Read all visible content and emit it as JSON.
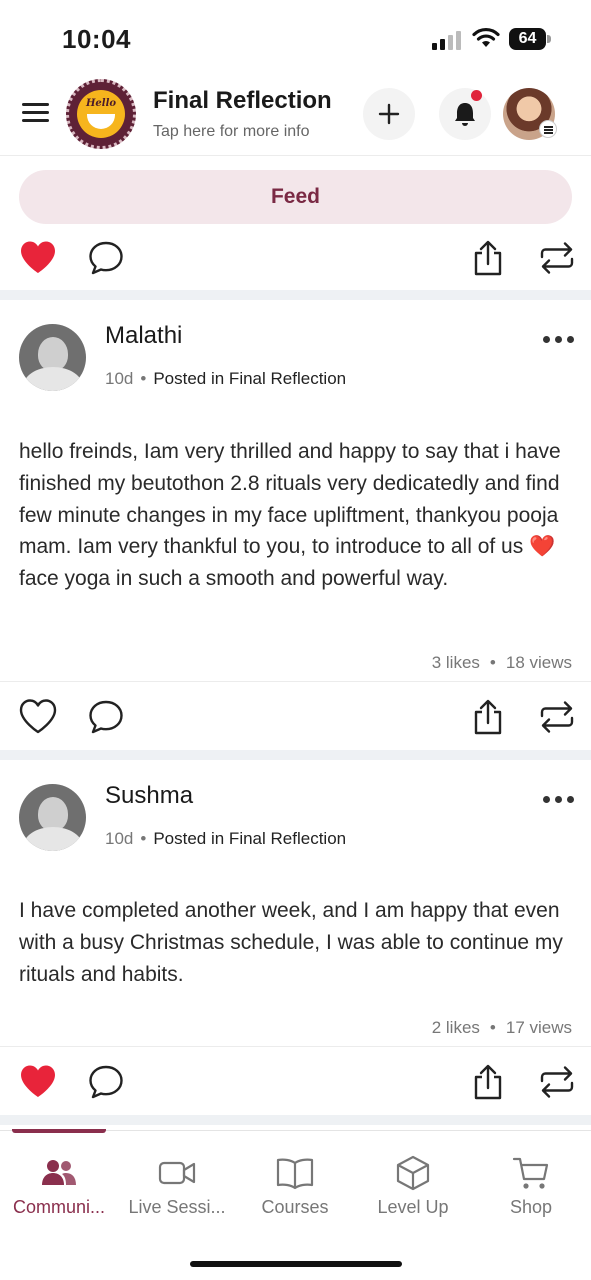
{
  "status_bar": {
    "time": "10:04",
    "battery": "64"
  },
  "header": {
    "title": "Final Reflection",
    "subtitle": "Tap here for more info",
    "logo_text": "Hello"
  },
  "feed_tab": {
    "label": "Feed"
  },
  "posts": [
    {
      "author": "Malathi",
      "time": "10d",
      "posted_in": "Posted in Final Reflection",
      "body": "hello freinds, Iam very thrilled and happy to say that i have  finished  my beutothon 2.8 rituals very dedicatedly and find few minute changes in my face upliftment, thankyou pooja mam. Iam very thankful to you, to introduce to all of us ❤️ face yoga in such a smooth and powerful way.",
      "likes": "3 likes",
      "views": "18 views",
      "liked": false
    },
    {
      "author": "Sushma",
      "time": "10d",
      "posted_in": "Posted in Final Reflection",
      "body": "I have completed another week, and I am happy that even with a busy Christmas schedule, I was able to continue my rituals and habits.",
      "likes": "2 likes",
      "views": "17 views",
      "liked": true
    }
  ],
  "tabs": [
    {
      "label": "Communi...",
      "icon": "community-icon",
      "active": true
    },
    {
      "label": "Live Sessi...",
      "icon": "video-icon",
      "active": false
    },
    {
      "label": "Courses",
      "icon": "book-icon",
      "active": false
    },
    {
      "label": "Level Up",
      "icon": "cube-icon",
      "active": false
    },
    {
      "label": "Shop",
      "icon": "cart-icon",
      "active": false
    }
  ],
  "colors": {
    "accent": "#8a2f4d",
    "like": "#e8243a",
    "pill_bg": "#f3e6ea"
  }
}
